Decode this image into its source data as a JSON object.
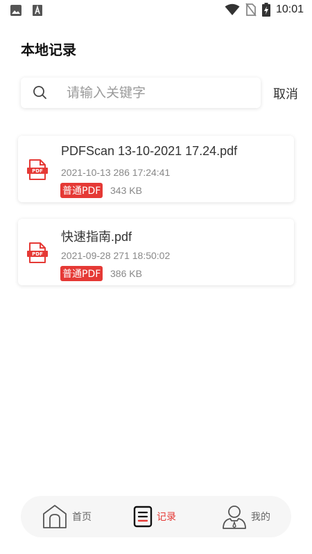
{
  "status_bar": {
    "time": "10:01",
    "icons": [
      "image-icon",
      "a-notification-icon",
      "wifi-icon",
      "no-sim-icon",
      "battery-charging-icon"
    ]
  },
  "page": {
    "title": "本地记录"
  },
  "search": {
    "placeholder": "请输入关键字",
    "value": "",
    "cancel_label": "取消"
  },
  "files": [
    {
      "name": "PDFScan 13-10-2021 17.24.pdf",
      "meta": "2021-10-13 286 17:24:41",
      "tag": "普通PDF",
      "size": "343 KB",
      "icon": "pdf-file-icon"
    },
    {
      "name": "快速指南.pdf",
      "meta": "2021-09-28 271 18:50:02",
      "tag": "普通PDF",
      "size": "386 KB",
      "icon": "pdf-file-icon"
    }
  ],
  "bottom_nav": {
    "items": [
      {
        "label": "首页",
        "icon": "home-icon",
        "active": false
      },
      {
        "label": "记录",
        "icon": "records-icon",
        "active": true
      },
      {
        "label": "我的",
        "icon": "profile-icon",
        "active": false
      }
    ]
  },
  "colors": {
    "accent": "#e53935",
    "text": "#222222",
    "muted": "#888888"
  }
}
